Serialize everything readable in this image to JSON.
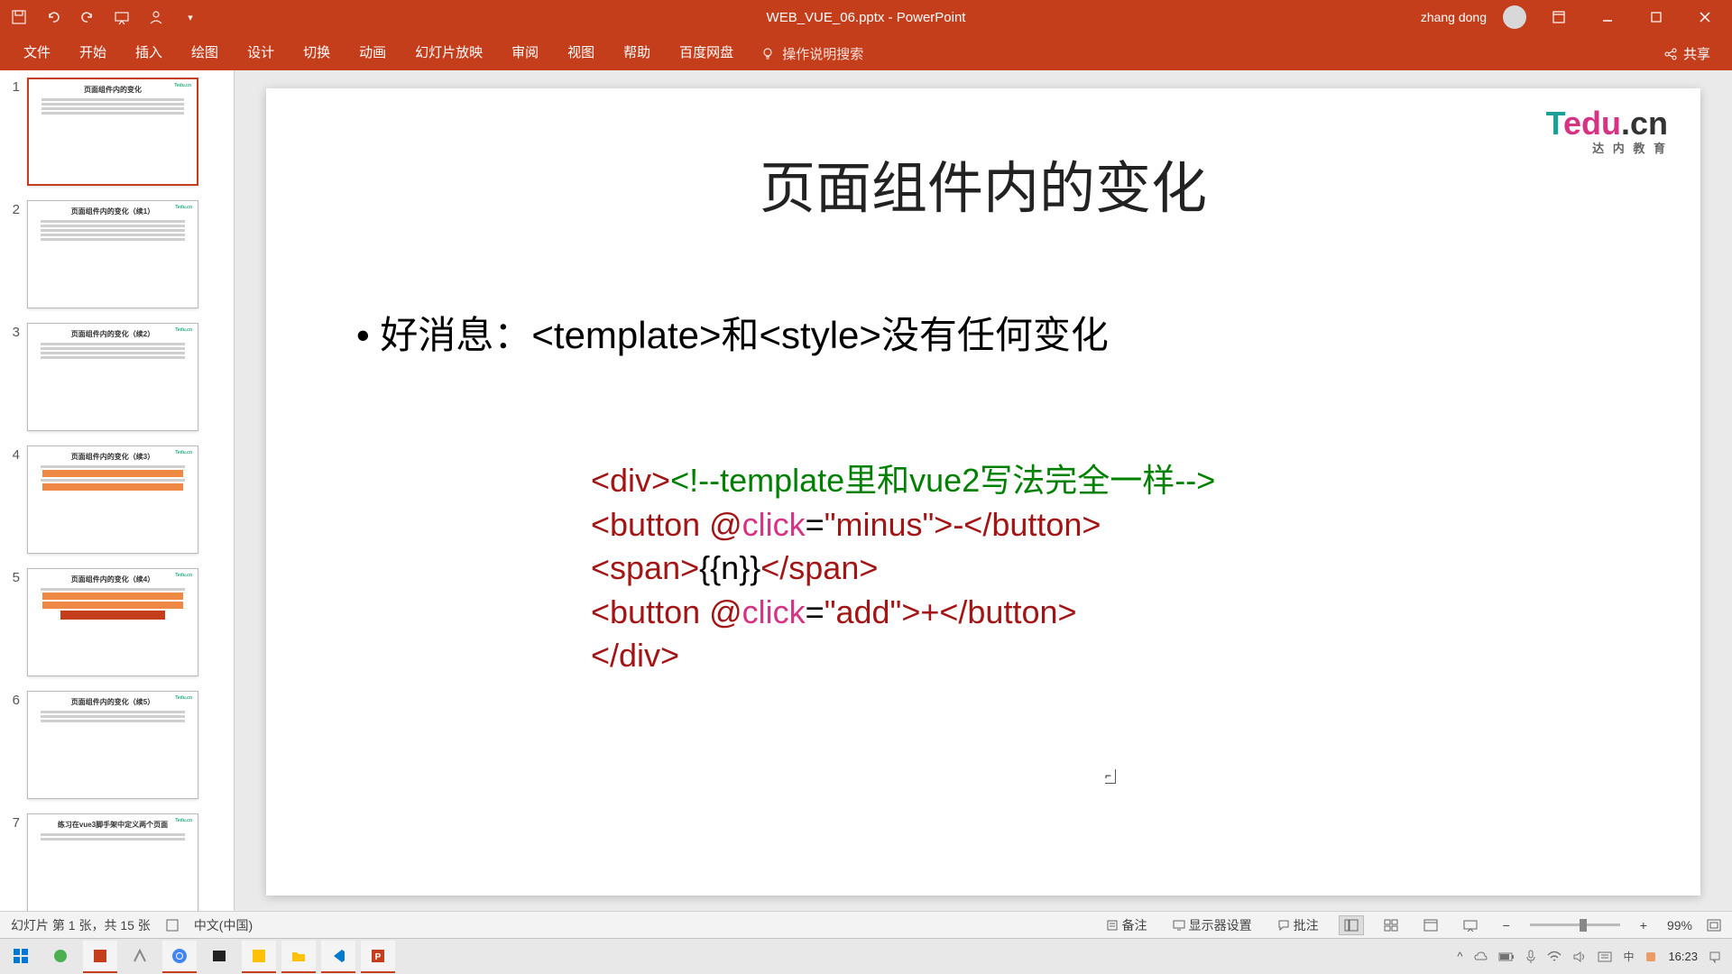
{
  "titlebar": {
    "title": "WEB_VUE_06.pptx - PowerPoint",
    "user": "zhang dong"
  },
  "ribbon": {
    "tabs": [
      "文件",
      "开始",
      "插入",
      "绘图",
      "设计",
      "切换",
      "动画",
      "幻灯片放映",
      "审阅",
      "视图",
      "帮助",
      "百度网盘"
    ],
    "search": "操作说明搜索",
    "share": "共享"
  },
  "thumbs": {
    "t1": "页面组件内的变化",
    "t2": "页面组件内的变化（续1）",
    "t3": "页面组件内的变化（续2）",
    "t4": "页面组件内的变化（续3）",
    "t5": "页面组件内的变化（续4）",
    "t6": "页面组件内的变化（续5）",
    "t7": "练习在vue3脚手架中定义两个页面"
  },
  "slide": {
    "logo_t": "T",
    "logo_edu": "edu",
    "logo_cn": ".cn",
    "logo_sub": "达 内 教 育",
    "title": "页面组件内的变化",
    "bullet": "• 好消息：<template>和<style>没有任何变化",
    "code": {
      "l1a": "<div>",
      "l1b": "<!--template里和vue2写法完全一样-->",
      "l2a": "  <button ",
      "l2b": "@",
      "l2c": "click",
      "l2d": "=",
      "l2e": "\"minus\">-</button>",
      "l3a": "  <span>",
      "l3b": "{{n}}",
      "l3c": "</span>",
      "l4a": "  <button ",
      "l4b": "@",
      "l4c": "click",
      "l4d": "=",
      "l4e": "\"add\">+</button>",
      "l5": "</div>"
    }
  },
  "statusbar": {
    "slide_info": "幻灯片 第 1 张，共 15 张",
    "lang": "中文(中国)",
    "notes": "备注",
    "display": "显示器设置",
    "comments": "批注",
    "zoom": "99%"
  },
  "taskbar": {
    "clock": "16:23"
  }
}
